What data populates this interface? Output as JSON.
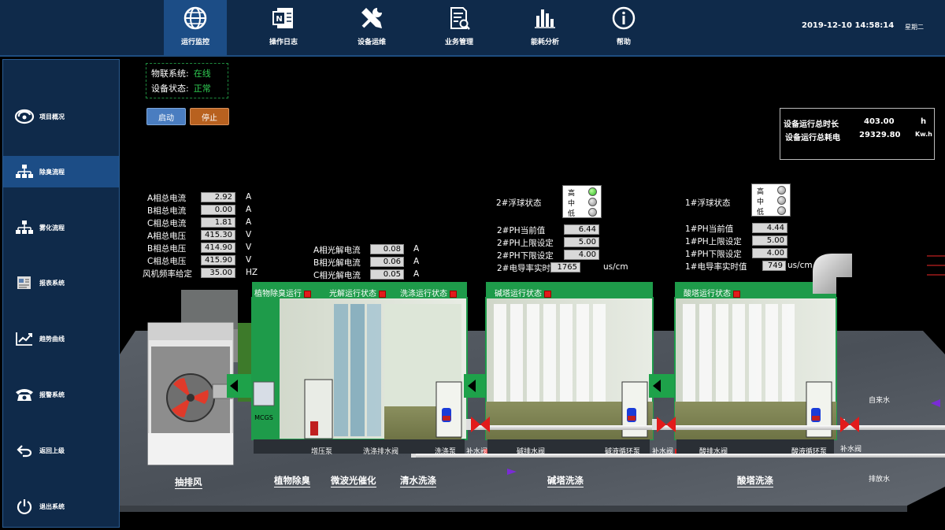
{
  "nav": {
    "items": [
      {
        "label": "运行监控",
        "icon": "globe-icon"
      },
      {
        "label": "操作日志",
        "icon": "note-icon"
      },
      {
        "label": "设备运维",
        "icon": "tools-icon"
      },
      {
        "label": "业务管理",
        "icon": "document-search-icon"
      },
      {
        "label": "能耗分析",
        "icon": "bar-chart-icon"
      },
      {
        "label": "帮助",
        "icon": "info-icon"
      }
    ],
    "datetime": "2019-12-10 14:58:14",
    "weekday": "星期二"
  },
  "sidebar": {
    "items": [
      {
        "label": "项目概况",
        "icon": "project-logo-icon"
      },
      {
        "label": "除臭流程",
        "icon": "flow-tree-icon"
      },
      {
        "label": "雾化流程",
        "icon": "flow-tree-icon"
      },
      {
        "label": "报表系统",
        "icon": "report-icon"
      },
      {
        "label": "趋势曲线",
        "icon": "trend-icon"
      },
      {
        "label": "报警系统",
        "icon": "phone-icon"
      },
      {
        "label": "返回上级",
        "icon": "return-icon"
      },
      {
        "label": "退出系统",
        "icon": "power-icon"
      }
    ]
  },
  "status": {
    "iot_label": "物联系统:",
    "iot_value": "在线",
    "device_label": "设备状态:",
    "device_value": "正常"
  },
  "buttons": {
    "start": "启动",
    "stop": "停止"
  },
  "totals": {
    "runtime_label": "设备运行总时长",
    "runtime_value": "403.00",
    "runtime_unit": "h",
    "energy_label": "设备运行总耗电",
    "energy_value": "29329.80",
    "energy_unit": "Kw.h"
  },
  "electrical": [
    {
      "label": "A相总电流",
      "value": "2.92",
      "unit": "A"
    },
    {
      "label": "B相总电流",
      "value": "0.00",
      "unit": "A"
    },
    {
      "label": "C相总电流",
      "value": "1.81",
      "unit": "A"
    },
    {
      "label": "A相总电压",
      "value": "415.30",
      "unit": "V"
    },
    {
      "label": "B相总电压",
      "value": "414.90",
      "unit": "V"
    },
    {
      "label": "C相总电压",
      "value": "415.90",
      "unit": "V"
    },
    {
      "label": "风机频率给定",
      "value": "35.00",
      "unit": "HZ"
    }
  ],
  "photolysis": [
    {
      "label": "A相光解电流",
      "value": "0.08",
      "unit": "A"
    },
    {
      "label": "B相光解电流",
      "value": "0.06",
      "unit": "A"
    },
    {
      "label": "C相光解电流",
      "value": "0.05",
      "unit": "A"
    }
  ],
  "tower2": {
    "float_label": "2#浮球状态",
    "levels": [
      "高",
      "中",
      "低"
    ],
    "rows": [
      {
        "label": "2#PH当前值",
        "value": "6.44",
        "unit": ""
      },
      {
        "label": "2#PH上限设定",
        "value": "5.00",
        "unit": ""
      },
      {
        "label": "2#PH下限设定",
        "value": "4.00",
        "unit": ""
      },
      {
        "label": "2#电导率实时值",
        "value": "1765",
        "unit": "us/cm"
      }
    ]
  },
  "tower1": {
    "float_label": "1#浮球状态",
    "levels": [
      "高",
      "中",
      "低"
    ],
    "rows": [
      {
        "label": "1#PH当前值",
        "value": "4.44",
        "unit": ""
      },
      {
        "label": "1#PH上限设定",
        "value": "5.00",
        "unit": ""
      },
      {
        "label": "1#PH下限设定",
        "value": "4.00",
        "unit": ""
      },
      {
        "label": "1#电导率实时值",
        "value": "749",
        "unit": "us/cm"
      }
    ]
  },
  "tanks": {
    "plant": "植物除臭运行",
    "light": "光解运行状态",
    "wash": "洗涤运行状态",
    "alkali": "碱塔运行状态",
    "acid": "酸塔运行状态"
  },
  "equipment": {
    "booster": "增压泵",
    "wash_drain": "洗涤排水阀",
    "wash_pump": "洗涤泵",
    "refill1": "补水阀",
    "alkali_drain": "碱排水阀",
    "alkali_pump": "碱液循环泵",
    "refill2": "补水阀",
    "acid_drain": "酸排水阀",
    "acid_pump": "酸液循环泵",
    "refill3": "补水阀",
    "mcgs": "MCGS",
    "tap_water": "自来水",
    "drain_water": "排放水"
  },
  "stages": {
    "fan": "抽排风",
    "plant": "植物除臭",
    "uv": "微波光催化",
    "water": "清水洗涤",
    "alkali": "碱塔洗涤",
    "acid": "酸塔洗涤"
  }
}
